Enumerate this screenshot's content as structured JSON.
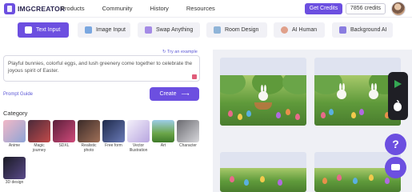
{
  "header": {
    "logo_text": "IMGCREATOR",
    "nav": [
      "Products",
      "Community",
      "History",
      "Resources"
    ],
    "get_credits_label": "Get Credits",
    "credits_badge": "7856 credits"
  },
  "tabs": [
    {
      "label": "Text Input",
      "active": true,
      "icon": "text-icon"
    },
    {
      "label": "Image Input",
      "active": false,
      "icon": "image-icon"
    },
    {
      "label": "Swap Anything",
      "active": false,
      "icon": "swap-icon"
    },
    {
      "label": "Room Design",
      "active": false,
      "icon": "room-icon"
    },
    {
      "label": "AI Human",
      "active": false,
      "icon": "human-icon"
    },
    {
      "label": "Background AI",
      "active": false,
      "icon": "background-icon"
    }
  ],
  "editor": {
    "try_example": "Try an example",
    "prompt_text": "Playful bunnies, colorful eggs, and lush greenery come together to celebrate the joyous spirit of Easter.",
    "prompt_guide": "Prompt Guide",
    "create_label": "Create"
  },
  "category": {
    "title": "Category",
    "items": [
      {
        "label": "Anime"
      },
      {
        "label": "Magic journey"
      },
      {
        "label": "SDXL"
      },
      {
        "label": "Realistic photo"
      },
      {
        "label": "Free form"
      },
      {
        "label": "Vector Illustration"
      },
      {
        "label": "Art"
      },
      {
        "label": "Character"
      },
      {
        "label": "3D design"
      }
    ]
  },
  "colors": {
    "accent": "#6c4fe0",
    "link": "#5b57d6"
  }
}
